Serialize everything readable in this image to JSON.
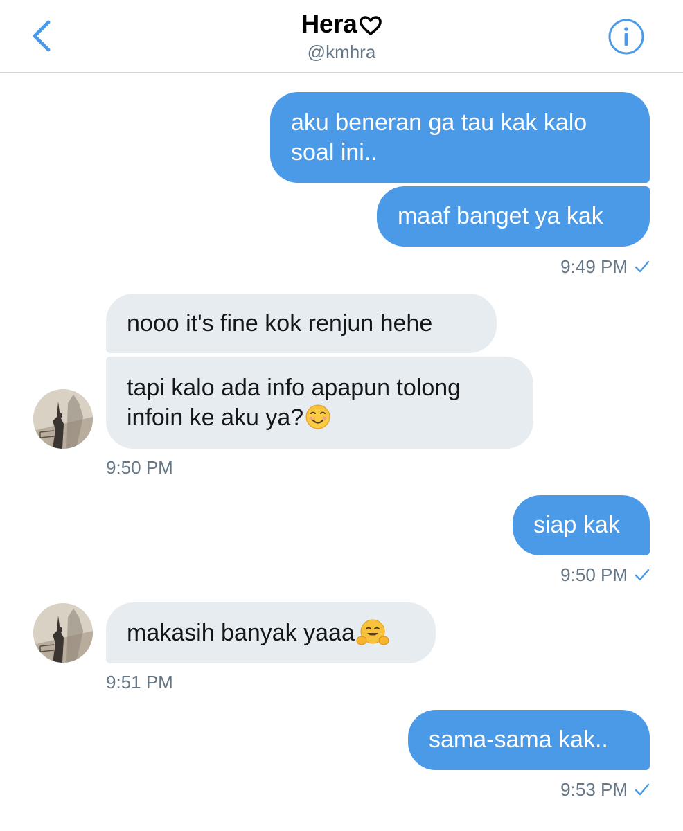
{
  "header": {
    "title": "Hera",
    "handle": "@kmhra"
  },
  "colors": {
    "accent": "#4a9ae8",
    "incoming_bubble": "#e6ecf0",
    "timestamp": "#657786"
  },
  "icons": {
    "back": "chevron-left-icon",
    "heart": "heart-outline-icon",
    "info": "info-circle-icon",
    "read": "check-icon",
    "emoji_smile": "smiling-face-emoji",
    "emoji_hug": "hugging-face-emoji"
  },
  "messages": [
    {
      "direction": "out",
      "text": "aku beneran ga tau kak kalo soal ini.."
    },
    {
      "direction": "out",
      "text": "maaf banget ya kak",
      "time": "9:49 PM"
    },
    {
      "direction": "in",
      "text": "nooo it's fine kok renjun hehe"
    },
    {
      "direction": "in",
      "text": "tapi kalo ada info apapun tolong infoin ke aku ya?",
      "emoji": "smiling-face-emoji",
      "time": "9:50 PM"
    },
    {
      "direction": "out",
      "text": "siap kak",
      "time": "9:50 PM"
    },
    {
      "direction": "in",
      "text": "makasih banyak yaaa",
      "emoji": "hugging-face-emoji",
      "time": "9:51 PM"
    },
    {
      "direction": "out",
      "text": "sama-sama kak..",
      "time": "9:53 PM"
    }
  ]
}
